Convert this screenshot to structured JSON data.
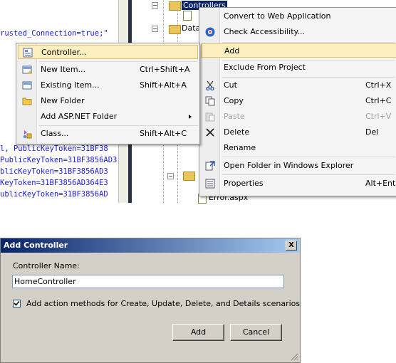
{
  "editor": {
    "lines_top": [
      "rusted_Connection=true;\""
    ],
    "lines_bottom": [
      "l, PublicKeyToken=31BF38",
      "PublicKeyToken=31BF3856AD3",
      "blicKeyToken=31BF3856AD3",
      "KeyToken=31BF3856AD364E3",
      "ublicKeyToken=31BF3856AD"
    ]
  },
  "solution_explorer": {
    "items": [
      "Controllers",
      "Data",
      "Error.aspx"
    ]
  },
  "add_submenu": {
    "items": [
      {
        "label": "Controller...",
        "shortcut": "",
        "icon": "controller-icon"
      },
      {
        "label": "New Item...",
        "shortcut": "Ctrl+Shift+A",
        "icon": "new-item-icon"
      },
      {
        "label": "Existing Item...",
        "shortcut": "Shift+Alt+A",
        "icon": "existing-item-icon"
      },
      {
        "label": "New Folder",
        "shortcut": "",
        "icon": "folder-icon"
      },
      {
        "label": "Add ASP.NET Folder",
        "shortcut": "",
        "icon": ""
      },
      {
        "label": "Class...",
        "shortcut": "Shift+Alt+C",
        "icon": "class-icon"
      }
    ]
  },
  "context_menu": {
    "items": [
      {
        "label": "Convert to Web Application",
        "shortcut": ""
      },
      {
        "label": "Check Accessibility...",
        "shortcut": ""
      },
      {
        "label": "Add",
        "shortcut": ""
      },
      {
        "label": "Exclude From Project",
        "shortcut": ""
      },
      {
        "label": "Cut",
        "shortcut": "Ctrl+X"
      },
      {
        "label": "Copy",
        "shortcut": "Ctrl+C"
      },
      {
        "label": "Paste",
        "shortcut": "Ctrl+V"
      },
      {
        "label": "Delete",
        "shortcut": "Del"
      },
      {
        "label": "Rename",
        "shortcut": ""
      },
      {
        "label": "Open Folder in Windows Explorer",
        "shortcut": ""
      },
      {
        "label": "Properties",
        "shortcut": "Alt+Enter"
      }
    ]
  },
  "dialog": {
    "title": "Add Controller",
    "close_label": "X",
    "name_label": "Controller Name:",
    "name_value": "HomeController",
    "checkbox_label": "Add action methods for Create, Update, Delete, and Details scenarios",
    "checkbox_checked": true,
    "add_label": "Add",
    "cancel_label": "Cancel"
  },
  "colors": {
    "menu_highlight": "#fdeec0",
    "title_bar": "#0a246a",
    "code_text": "#1a1ad8",
    "dialog_bg": "#d4d0c8"
  }
}
